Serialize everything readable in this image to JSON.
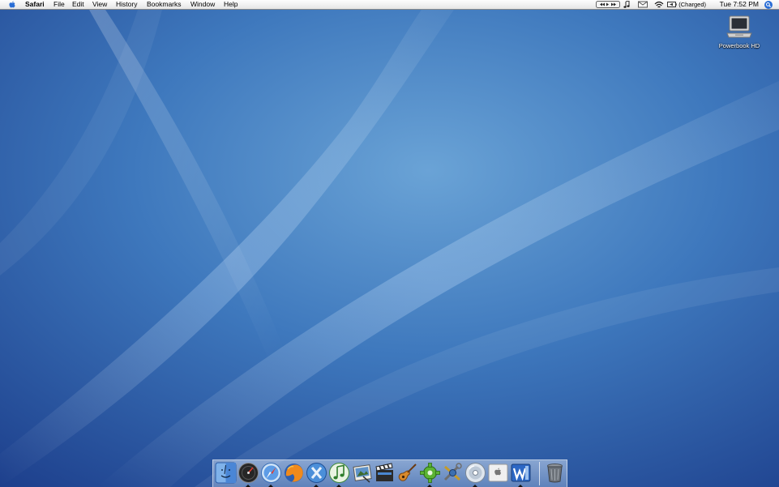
{
  "menubar": {
    "app_name": "Safari",
    "menus": [
      "File",
      "Edit",
      "View",
      "History",
      "Bookmarks",
      "Window",
      "Help"
    ],
    "status": {
      "battery": "(Charged)",
      "clock": "Tue 7:52 PM"
    }
  },
  "desktop": {
    "icons": [
      {
        "label": "Powerbook HD",
        "icon": "laptop-hard-drive-icon"
      }
    ]
  },
  "dock": {
    "items": [
      {
        "name": "finder",
        "icon": "finder-icon",
        "running": true
      },
      {
        "name": "dashboard",
        "icon": "dashboard-icon",
        "running": true
      },
      {
        "name": "safari",
        "icon": "safari-compass-icon",
        "running": true
      },
      {
        "name": "firefox",
        "icon": "firefox-icon",
        "running": false
      },
      {
        "name": "x-app",
        "icon": "x-logo-icon",
        "running": true
      },
      {
        "name": "itunes",
        "icon": "itunes-note-icon",
        "running": true
      },
      {
        "name": "iphoto",
        "icon": "iphoto-icon",
        "running": false
      },
      {
        "name": "imovie",
        "icon": "clapperboard-icon",
        "running": false
      },
      {
        "name": "garageband",
        "icon": "guitar-icon",
        "running": false
      },
      {
        "name": "gear-app",
        "icon": "green-gear-icon",
        "running": true
      },
      {
        "name": "utility-app",
        "icon": "tools-icon",
        "running": false
      },
      {
        "name": "dvd-player",
        "icon": "disc-icon",
        "running": true
      },
      {
        "name": "apple-app",
        "icon": "apple-box-icon",
        "running": false
      },
      {
        "name": "word",
        "icon": "w-document-icon",
        "running": true
      },
      {
        "name": "trash",
        "icon": "trash-can-icon",
        "running": false
      }
    ]
  },
  "colors": {
    "wallpaper_deep": "#1d3f8c",
    "wallpaper_mid": "#3a74b8",
    "wallpaper_light": "#7fb4dc",
    "spotlight": "#2a6ed6"
  }
}
